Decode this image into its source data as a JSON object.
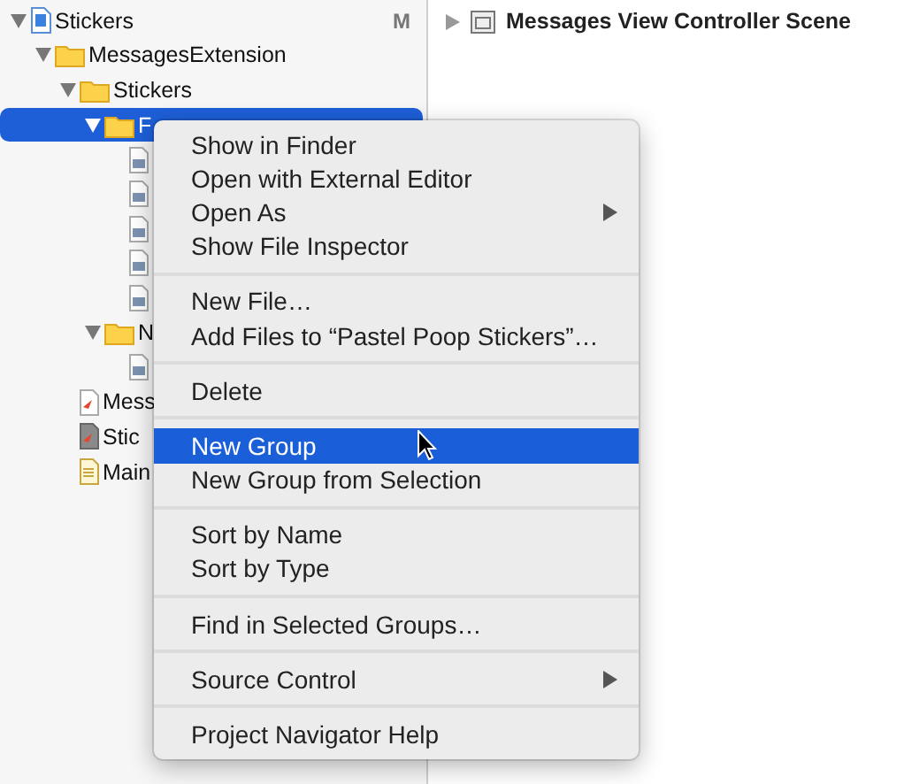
{
  "navigator": {
    "tree": [
      {
        "kind": "project",
        "label": "Stickers",
        "badge": "M",
        "expanded": true,
        "selected": false,
        "children": [
          {
            "kind": "folder",
            "label": "MessagesExtension",
            "expanded": true,
            "selected": false,
            "children": [
              {
                "kind": "folder",
                "label": "Stickers",
                "expanded": true,
                "selected": false,
                "children": [
                  {
                    "kind": "folder",
                    "label": "F",
                    "expanded": true,
                    "selected": true,
                    "children": [
                      {
                        "kind": "image",
                        "selected": false
                      },
                      {
                        "kind": "image",
                        "selected": false
                      },
                      {
                        "kind": "image",
                        "selected": false
                      },
                      {
                        "kind": "image",
                        "selected": false
                      },
                      {
                        "kind": "image",
                        "selected": false
                      }
                    ]
                  },
                  {
                    "kind": "folder",
                    "label": "N",
                    "expanded": true,
                    "selected": false,
                    "children": [
                      {
                        "kind": "image",
                        "selected": false
                      }
                    ]
                  }
                ]
              },
              {
                "kind": "swift",
                "label": "Mess",
                "selected": false
              },
              {
                "kind": "assets",
                "label": "Stic",
                "selected": false
              },
              {
                "kind": "plist",
                "label": "Main",
                "selected": false
              }
            ]
          }
        ]
      }
    ]
  },
  "scene_pane": {
    "label": "Messages View Controller Scene",
    "expanded": false
  },
  "context_menu": {
    "groups": [
      [
        {
          "label": "Show in Finder",
          "submenu": false,
          "selected": false
        },
        {
          "label": "Open with External Editor",
          "submenu": false,
          "selected": false
        },
        {
          "label": "Open As",
          "submenu": true,
          "selected": false
        },
        {
          "label": "Show File Inspector",
          "submenu": false,
          "selected": false
        }
      ],
      [
        {
          "label": "New File…",
          "submenu": false,
          "selected": false
        },
        {
          "label": "Add Files to “Pastel Poop Stickers”…",
          "submenu": false,
          "selected": false
        }
      ],
      [
        {
          "label": "Delete",
          "submenu": false,
          "selected": false
        }
      ],
      [
        {
          "label": "New Group",
          "submenu": false,
          "selected": true
        },
        {
          "label": "New Group from Selection",
          "submenu": false,
          "selected": false
        }
      ],
      [
        {
          "label": "Sort by Name",
          "submenu": false,
          "selected": false
        },
        {
          "label": "Sort by Type",
          "submenu": false,
          "selected": false
        }
      ],
      [
        {
          "label": "Find in Selected Groups…",
          "submenu": false,
          "selected": false
        }
      ],
      [
        {
          "label": "Source Control",
          "submenu": true,
          "selected": false
        }
      ],
      [
        {
          "label": "Project Navigator Help",
          "submenu": false,
          "selected": false
        }
      ]
    ]
  }
}
